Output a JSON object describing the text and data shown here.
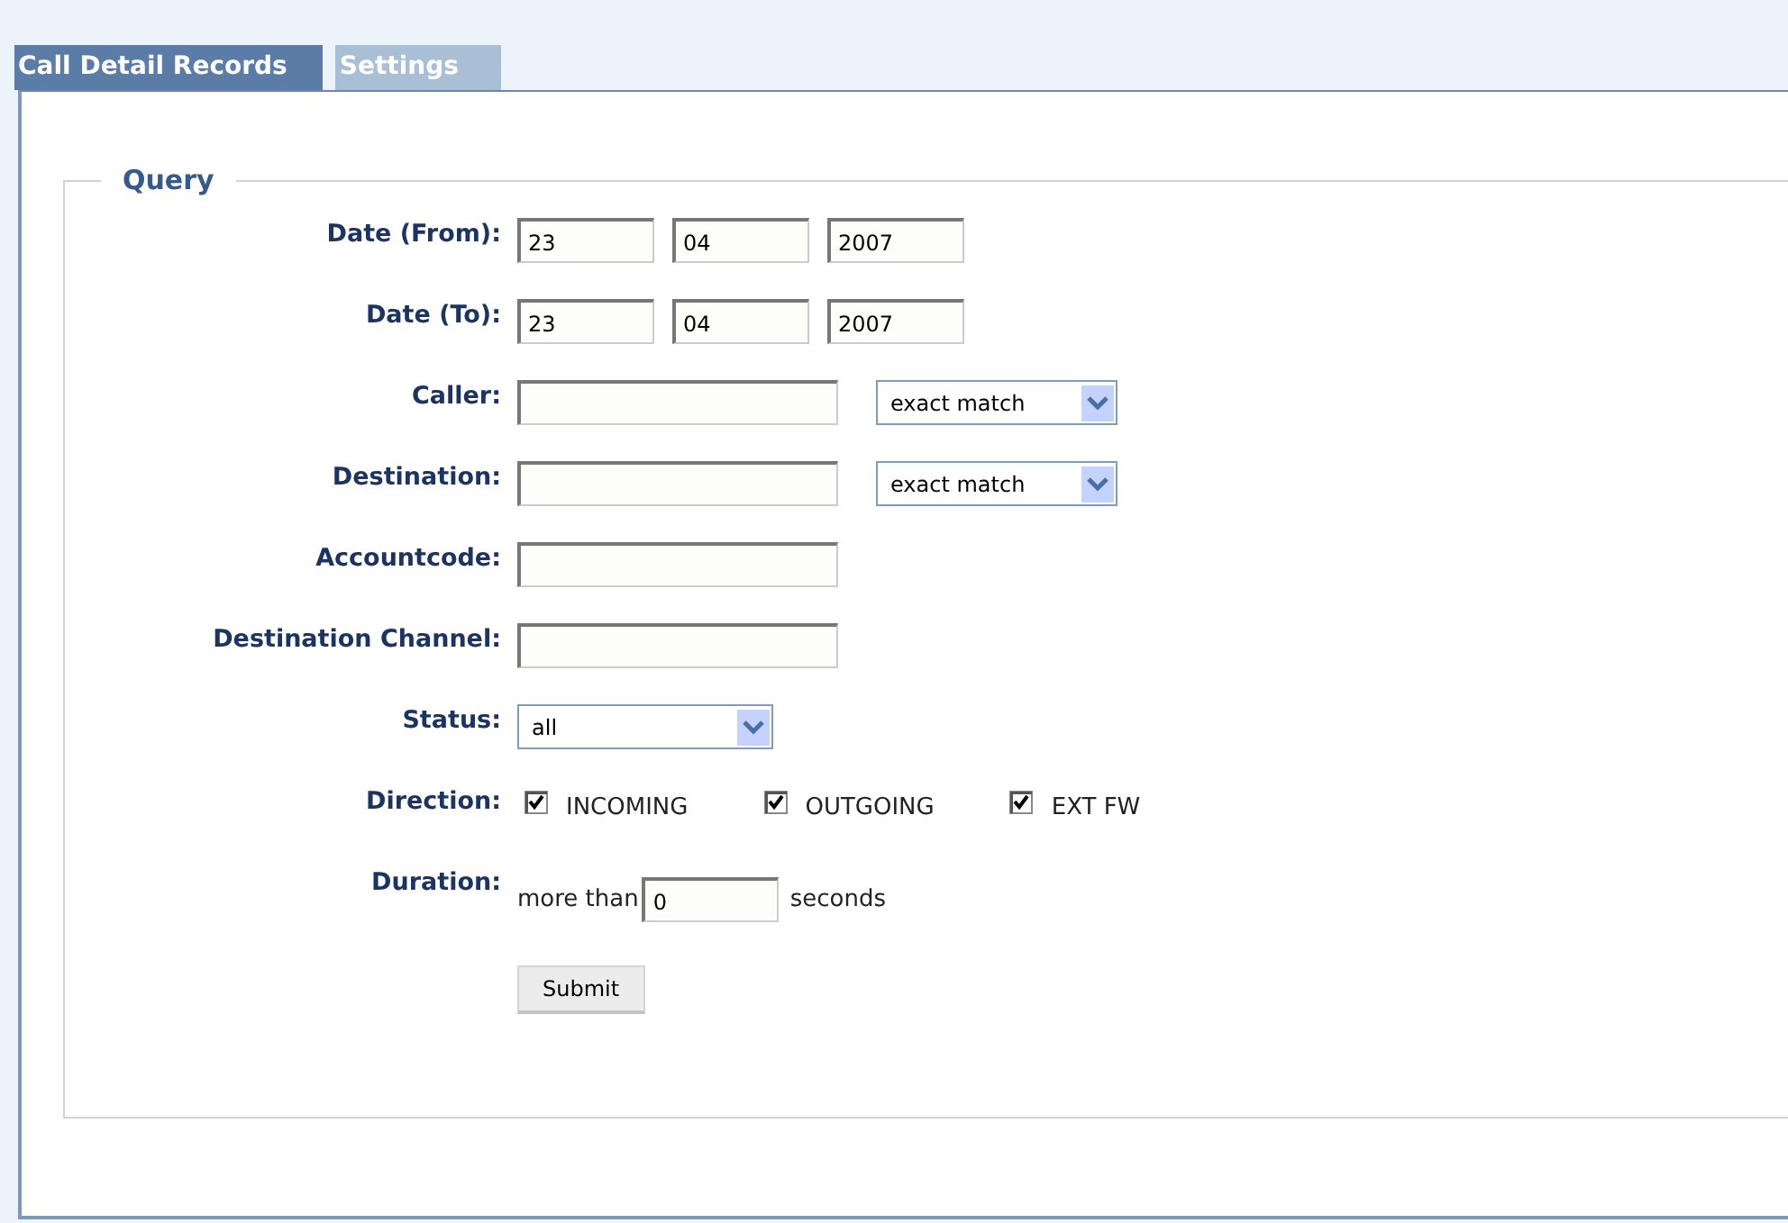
{
  "tabs": [
    {
      "label": "Call Detail Records",
      "selected": true
    },
    {
      "label": "Settings",
      "selected": false
    }
  ],
  "query": {
    "legend": "Query",
    "fields": [
      {
        "kind": "date",
        "label": "Date (From):",
        "values": [
          "23",
          "04",
          "2007"
        ]
      },
      {
        "kind": "date",
        "label": "Date (To):",
        "values": [
          "23",
          "04",
          "2007"
        ]
      },
      {
        "kind": "text_match",
        "label": "Caller:",
        "match": "exact match"
      },
      {
        "kind": "text_match",
        "label": "Destination:",
        "match": "exact match"
      },
      {
        "kind": "text",
        "label": "Accountcode:"
      },
      {
        "kind": "text",
        "label": "Destination Channel:"
      },
      {
        "kind": "select",
        "label": "Status:",
        "value": "all"
      },
      {
        "kind": "checks",
        "label": "Direction:",
        "options": [
          {
            "label": "INCOMING",
            "checked": true
          },
          {
            "label": "OUTGOING",
            "checked": true
          },
          {
            "label": "EXT FW",
            "checked": true
          }
        ]
      },
      {
        "kind": "duration",
        "label": "Duration:",
        "prefix": "more than",
        "value": "0",
        "suffix": "seconds"
      }
    ],
    "submit": "Submit"
  }
}
